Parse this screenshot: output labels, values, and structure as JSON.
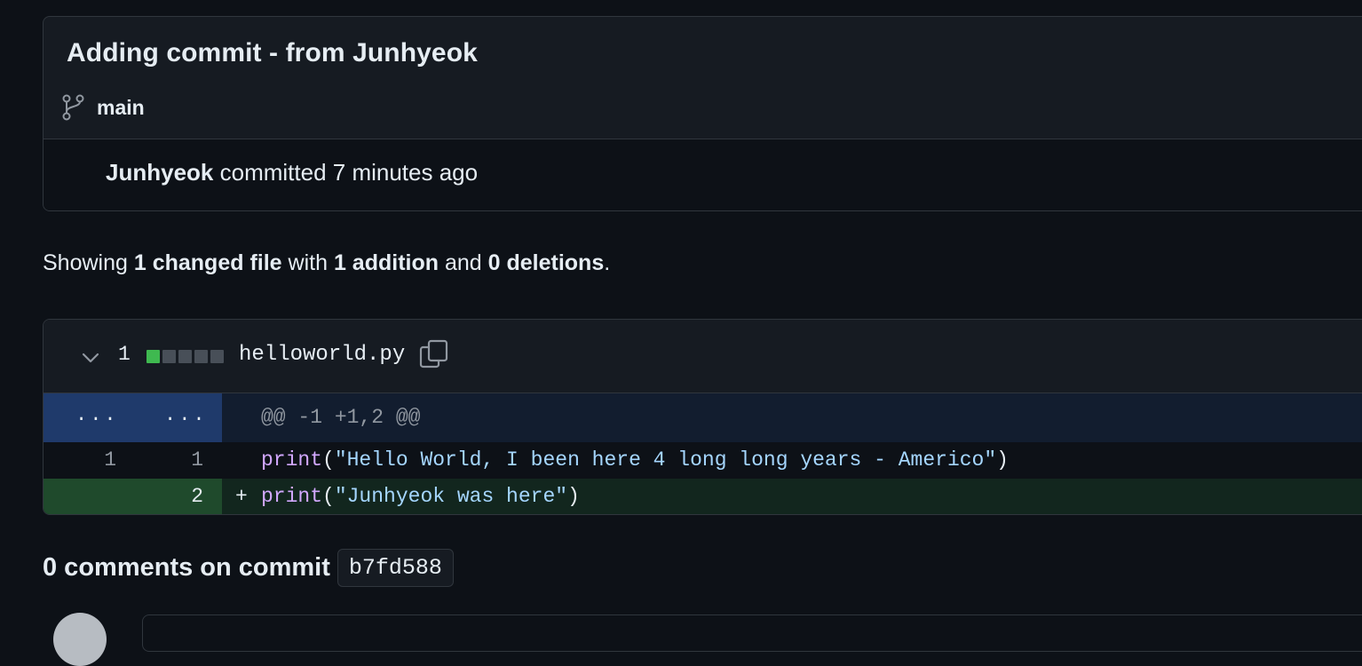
{
  "commit": {
    "title": "Adding commit - from Junhyeok",
    "branch": "main",
    "author": "Junhyeok",
    "action": "committed",
    "time": "7 minutes ago"
  },
  "summary": {
    "prefix": "Showing",
    "changed_files": "1 changed file",
    "with": "with",
    "additions": "1 addition",
    "and": "and",
    "deletions": "0 deletions",
    "suffix": "."
  },
  "file": {
    "change_count": "1",
    "diffstat": {
      "additions": 1,
      "neutral": 4
    },
    "name": "helloworld.py",
    "hunk": {
      "old_expander": "...",
      "new_expander": "...",
      "header": "@@ -1 +1,2 @@"
    },
    "lines": [
      {
        "old": "1",
        "new": "1",
        "sign": "",
        "fn": "print",
        "open": "(",
        "str": "\"Hello World, I been here 4 long long years - Americo\"",
        "close": ")"
      },
      {
        "old": "",
        "new": "2",
        "sign": "+",
        "fn": "print",
        "open": "(",
        "str": "\"Junhyeok was here\"",
        "close": ")"
      }
    ]
  },
  "comments": {
    "heading": "0 comments on commit",
    "sha": "b7fd588"
  },
  "icons": {
    "branch": "git-branch-icon",
    "chevron": "chevron-down-icon",
    "copy": "copy-icon"
  },
  "colors": {
    "background": "#0d1117",
    "addition": "#3fb950",
    "hunk_gutter": "#1f3a6b",
    "add_gutter": "#1f4a2c",
    "function": "#d2a8ff",
    "string": "#a5d6ff"
  }
}
